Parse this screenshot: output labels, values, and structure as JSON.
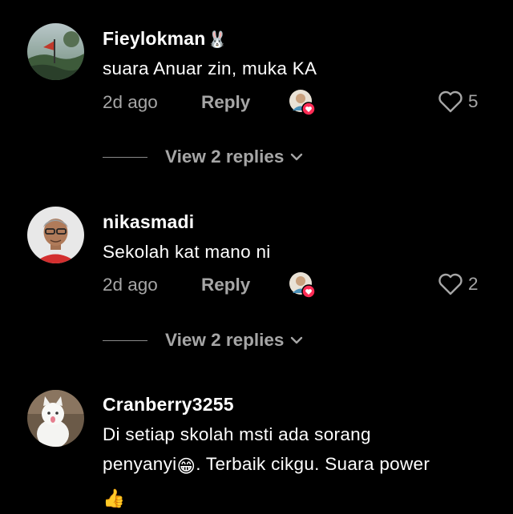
{
  "comments": [
    {
      "username": "Fieylokman",
      "username_emoji": "🐰",
      "text": "suara Anuar zin, muka KA",
      "time": "2d ago",
      "reply_label": "Reply",
      "likes": "5",
      "view_replies": "View 2 replies"
    },
    {
      "username": "nikasmadi",
      "text": "Sekolah kat mano ni",
      "time": "2d ago",
      "reply_label": "Reply",
      "likes": "2",
      "view_replies": "View 2 replies"
    },
    {
      "username": "Cranberry3255",
      "text_part1": "Di setiap skolah msti ada sorang",
      "text_part2_prefix": "penyanyi",
      "text_part2_emoji": "😁",
      "text_part2_suffix": ". Terbaik cikgu. Suara power",
      "text_part3_emoji": "👍"
    }
  ],
  "colors": {
    "background": "#000000",
    "text": "#ffffff",
    "muted": "#a6a6a6",
    "creator_heart": "#fe2c55"
  }
}
